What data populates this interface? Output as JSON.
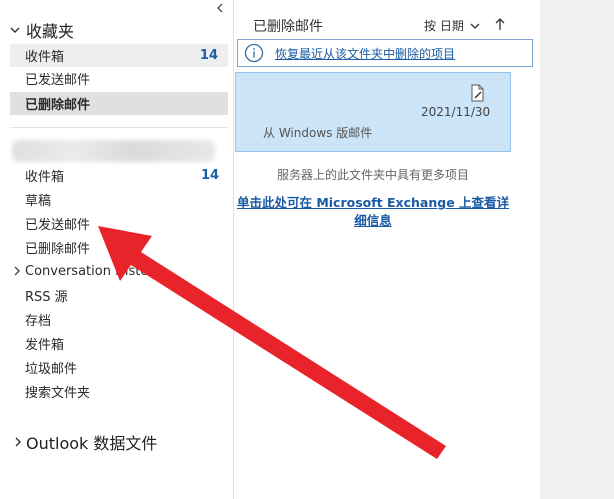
{
  "favorites": {
    "header": "收藏夹",
    "items": [
      {
        "label": "收件箱",
        "count": "14"
      },
      {
        "label": "已发送邮件"
      },
      {
        "label": "已删除邮件"
      }
    ]
  },
  "account": {
    "folders": [
      {
        "label": "收件箱",
        "count": "14"
      },
      {
        "label": "草稿"
      },
      {
        "label": "已发送邮件"
      },
      {
        "label": "已删除邮件"
      },
      {
        "label": "Conversation History"
      },
      {
        "label": "RSS 源"
      },
      {
        "label": "存档"
      },
      {
        "label": "发件箱"
      },
      {
        "label": "垃圾邮件"
      },
      {
        "label": "搜索文件夹"
      }
    ]
  },
  "data_file": {
    "label": "Outlook 数据文件"
  },
  "message_list": {
    "title": "已删除邮件",
    "sort_label": "按 日期",
    "info_link": "恢复最近从该文件夹中删除的项目",
    "message": {
      "date": "2021/11/30",
      "preview": "从 Windows 版邮件"
    },
    "more_items": "服务器上的此文件夹中具有更多项目",
    "exchange_link": "单击此处可在 Microsoft Exchange 上查看详细信息"
  },
  "colors": {
    "arrow": "#e8232a",
    "selected_message": "#cce4f7",
    "link": "#1a5aa6"
  }
}
